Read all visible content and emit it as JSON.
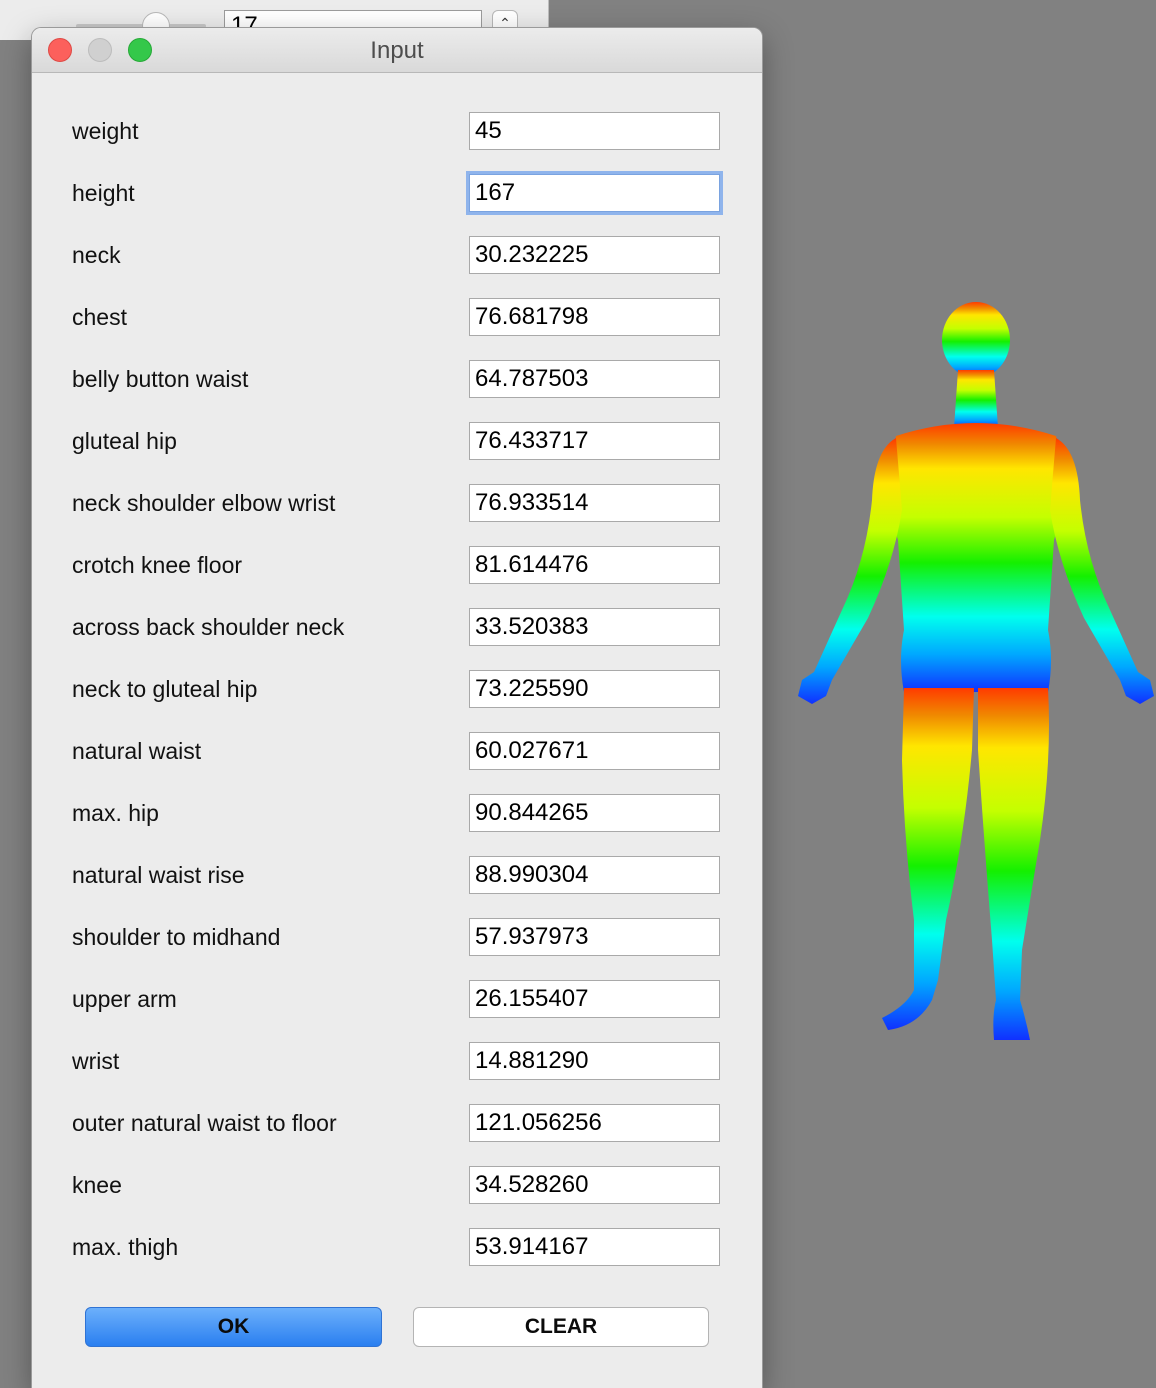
{
  "background_window": {
    "field_value": "17",
    "stepper_icon": "chevron-up-icon"
  },
  "dialog": {
    "title": "Input",
    "window_controls": [
      "close",
      "minimize",
      "zoom"
    ],
    "fields": [
      {
        "label": "weight",
        "value": "45"
      },
      {
        "label": "height",
        "value": "167",
        "focused": true
      },
      {
        "label": "neck",
        "value": "30.232225"
      },
      {
        "label": "chest",
        "value": "76.681798"
      },
      {
        "label": "belly button waist",
        "value": "64.787503"
      },
      {
        "label": "gluteal hip",
        "value": "76.433717"
      },
      {
        "label": "neck shoulder elbow wrist",
        "value": "76.933514"
      },
      {
        "label": "crotch knee floor",
        "value": "81.614476"
      },
      {
        "label": "across back shoulder neck",
        "value": "33.520383"
      },
      {
        "label": "neck to gluteal hip",
        "value": "73.225590"
      },
      {
        "label": "natural waist",
        "value": "60.027671"
      },
      {
        "label": "max. hip",
        "value": "90.844265"
      },
      {
        "label": "natural waist rise",
        "value": "88.990304"
      },
      {
        "label": "shoulder to midhand",
        "value": "57.937973"
      },
      {
        "label": "upper arm",
        "value": "26.155407"
      },
      {
        "label": "wrist",
        "value": "14.881290"
      },
      {
        "label": "outer natural waist to floor",
        "value": "121.056256"
      },
      {
        "label": "knee",
        "value": "34.528260"
      },
      {
        "label": "max. thigh",
        "value": "53.914167"
      }
    ],
    "ok_label": "OK",
    "clear_label": "CLEAR"
  },
  "viewport": {
    "background_color": "#818181",
    "model_gradient": [
      "#ff3b00",
      "#ffe600",
      "#b5ff00",
      "#14f000",
      "#00ffee",
      "#1030ff"
    ]
  }
}
